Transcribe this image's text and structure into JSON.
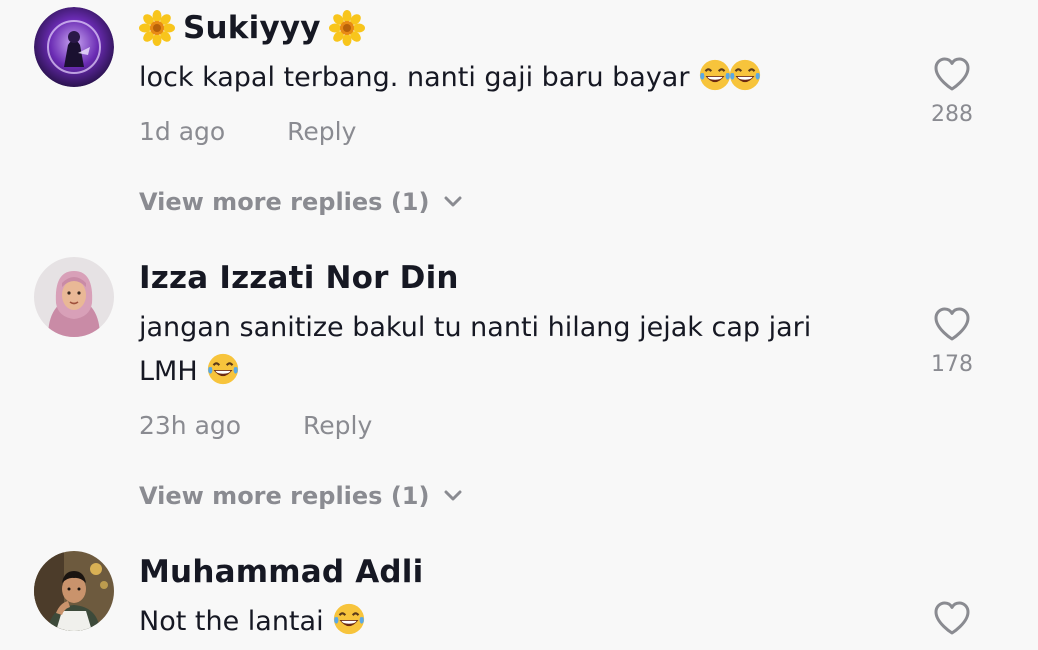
{
  "comments": [
    {
      "username": "Sukiyyy",
      "username_decoration": "sunflower-emoji",
      "text": "lock kapal terbang. nanti gaji baru bayar",
      "emoji_suffix": [
        "joy-emoji",
        "joy-emoji"
      ],
      "time": "1d ago",
      "reply_label": "Reply",
      "likes": "288",
      "view_more": "View more replies (1)"
    },
    {
      "username": "Izza Izzati Nor Din",
      "text_line1": "jangan sanitize bakul tu nanti hilang jejak cap jari",
      "text_line2": "LMH",
      "emoji_suffix": [
        "joy-emoji"
      ],
      "time": "23h ago",
      "reply_label": "Reply",
      "likes": "178",
      "view_more": "View more replies (1)"
    },
    {
      "username": "Muhammad Adli",
      "text": "Not the lantai",
      "emoji_suffix": [
        "joy-emoji"
      ]
    }
  ],
  "colors": {
    "background": "#f8f8f8",
    "primary_text": "#161823",
    "secondary_text": "#8a8b91"
  },
  "icons": [
    "heart-outline-icon",
    "chevron-down-icon",
    "sunflower-emoji",
    "joy-emoji"
  ]
}
